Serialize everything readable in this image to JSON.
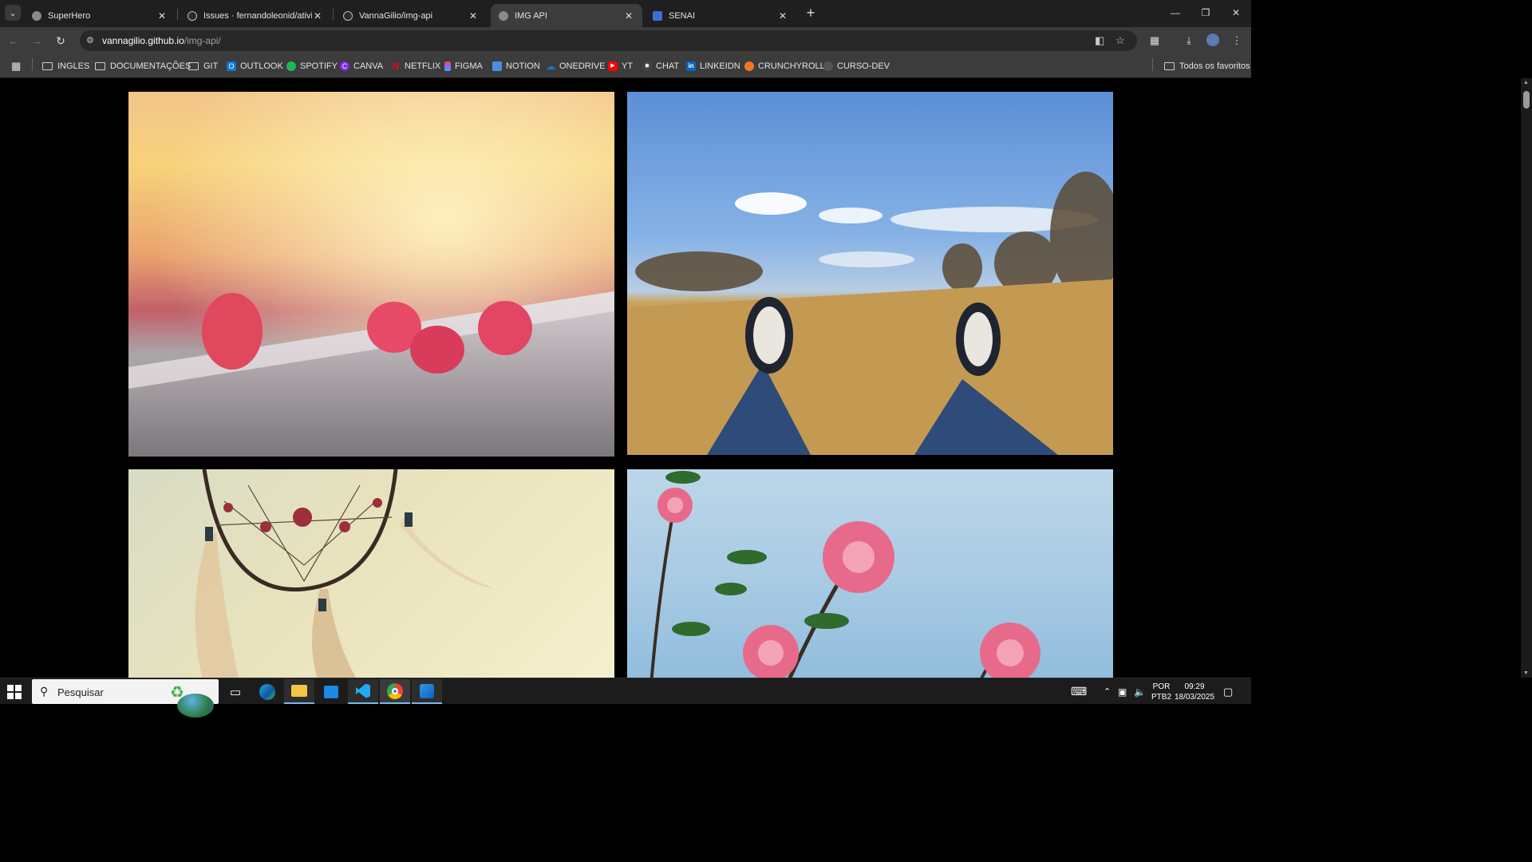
{
  "browser": {
    "tabs": [
      {
        "title": "SuperHero",
        "active": false,
        "icon": "globe-icon"
      },
      {
        "title": "Issues · fernandoleonid/atividade",
        "active": false,
        "icon": "github-icon"
      },
      {
        "title": "VannaGilio/img-api",
        "active": false,
        "icon": "github-icon"
      },
      {
        "title": "IMG API",
        "active": true,
        "icon": "globe-icon"
      },
      {
        "title": "SENAI",
        "active": false,
        "icon": "senai-icon"
      }
    ],
    "new_tab": "+",
    "close_glyph": "✕",
    "url_host": "vannagilio.github.io",
    "url_path": "/img-api/",
    "bookmarks": [
      {
        "label": "INGLES",
        "icon": "folder-icon"
      },
      {
        "label": "DOCUMENTAÇÕES",
        "icon": "folder-icon"
      },
      {
        "label": "GIT",
        "icon": "folder-icon"
      },
      {
        "label": "OUTLOOK",
        "icon": "outlook-icon",
        "color": "#0f78d4"
      },
      {
        "label": "SPOTIFY",
        "icon": "spotify-icon",
        "color": "#1db954"
      },
      {
        "label": "CANVA",
        "icon": "canva-icon",
        "color": "#7d2ae8"
      },
      {
        "label": "NETFLIX",
        "icon": "netflix-icon",
        "color": "#e50914"
      },
      {
        "label": "FIGMA",
        "icon": "figma-icon",
        "color": "#f24e1e"
      },
      {
        "label": "NOTION",
        "icon": "notion-icon",
        "color": "#4a90e2"
      },
      {
        "label": "ONEDRIVE",
        "icon": "onedrive-icon",
        "color": "#0f78d4"
      },
      {
        "label": "YT",
        "icon": "youtube-icon",
        "color": "#ff0000"
      },
      {
        "label": "CHAT",
        "icon": "chatgpt-icon",
        "color": "#444444"
      },
      {
        "label": "LINKEIDN",
        "icon": "linkedin-icon",
        "color": "#0a66c2"
      },
      {
        "label": "CRUNCHYROLL",
        "icon": "crunchyroll-icon",
        "color": "#f47521"
      },
      {
        "label": "CURSO-DEV",
        "icon": "globe-icon",
        "color": "#555555"
      }
    ],
    "all_bookmarks": "Todos os favoritos"
  },
  "page": {
    "images": [
      {
        "subject": "raspberries on wooden rail",
        "icon": "photo-raspberries"
      },
      {
        "subject": "sneakers on grass field",
        "icon": "photo-field-feet"
      },
      {
        "subject": "dreamcatcher",
        "icon": "photo-dreamcatcher"
      },
      {
        "subject": "pink flowers against sky",
        "icon": "photo-flowers"
      }
    ]
  },
  "taskbar": {
    "search_placeholder": "Pesquisar",
    "language": "POR",
    "keyboard": "PTB2",
    "time": "09:29",
    "date": "18/03/2025"
  }
}
